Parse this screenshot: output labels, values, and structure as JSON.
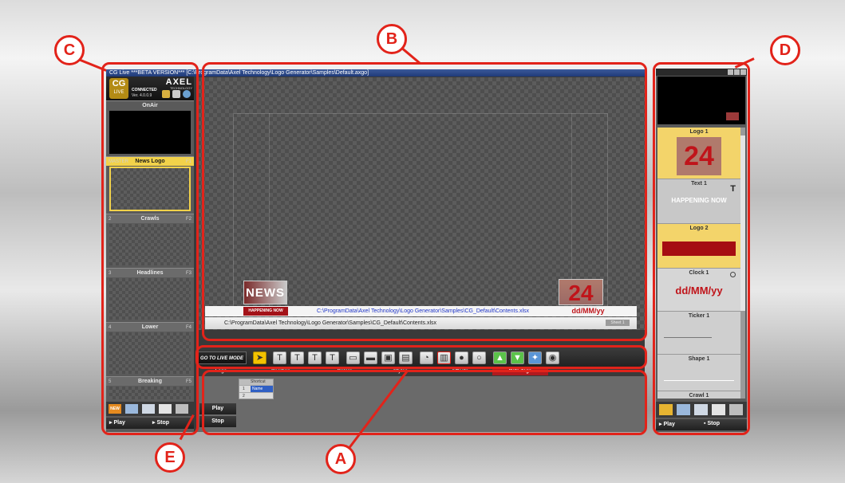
{
  "app": {
    "title": "CG Live ***BETA VERSION*** [C:\\ProgramData\\Axel Technology\\Logo Generator\\Samples\\Default.axgo]",
    "logo_text": "CG",
    "logo_sub": "LIVE",
    "brand": "AXEL",
    "brand_sub": "TECHNOLOGY",
    "status": "CONNECTED",
    "version": "Ver. 4.0.0.9"
  },
  "callouts": {
    "a": "A",
    "b": "B",
    "c": "C",
    "d": "D",
    "e": "E"
  },
  "left_panel": {
    "onair_label": "OnAir",
    "slots": [
      {
        "num": "MASTER",
        "name": "News Logo",
        "key": "F1"
      },
      {
        "num": "2",
        "name": "Crawls",
        "key": "F2"
      },
      {
        "num": "3",
        "name": "Headlines",
        "key": "F3"
      },
      {
        "num": "4",
        "name": "Lower",
        "key": "F4"
      },
      {
        "num": "5",
        "name": "Breaking",
        "key": "F5"
      }
    ],
    "play_label": "Play",
    "stop_label": "Stop",
    "new_label": "NEW"
  },
  "canvas": {
    "news_logo_text": "NEWS",
    "happening_now": "HAPPENING NOW",
    "contents_path": "C:\\ProgramData\\Axel Technology\\Logo Generator\\Samples\\CG_Default\\Contents.xlsx",
    "clock_value": "24",
    "date_format": "dd/MM/yy",
    "bottom_path": "C:\\ProgramData\\Axel Technology\\Logo Generator\\Samples\\CG_Default\\Contents.xlsx",
    "bottom_tag": "Sheet 1"
  },
  "toolbar": {
    "live_mode_label": "GO TO LIVE MODE",
    "tabs": [
      "Logo",
      "Position",
      "Colors",
      "Styles",
      "Effects",
      "Data Tags"
    ],
    "text_tools": [
      "T",
      "T",
      "T",
      "T"
    ],
    "text_tool_captions": [
      "",
      "CRAWL",
      "ROLL",
      "TICKER"
    ]
  },
  "bottom": {
    "grid_header": "Shortcut",
    "grid_rows": [
      {
        "num": "1",
        "value": "Name"
      },
      {
        "num": "2",
        "value": ""
      }
    ],
    "play_label": "Play",
    "stop_label": "Stop"
  },
  "right_panel": {
    "preview_text": "",
    "items": [
      {
        "name": "Logo 1",
        "content": "24"
      },
      {
        "name": "Text 1",
        "content": "HAPPENING NOW"
      },
      {
        "name": "Logo 2",
        "content": ""
      },
      {
        "name": "Clock 1",
        "content": "dd/MM/yy"
      },
      {
        "name": "Ticker 1",
        "content": ""
      },
      {
        "name": "Shape 1",
        "content": ""
      },
      {
        "name": "Crawl 1",
        "content": ""
      }
    ],
    "play_label": "Play",
    "stop_label": "Stop"
  },
  "colors": {
    "callout": "#e2231a",
    "selected": "#f2d24a",
    "accent_red": "#c0141a"
  }
}
